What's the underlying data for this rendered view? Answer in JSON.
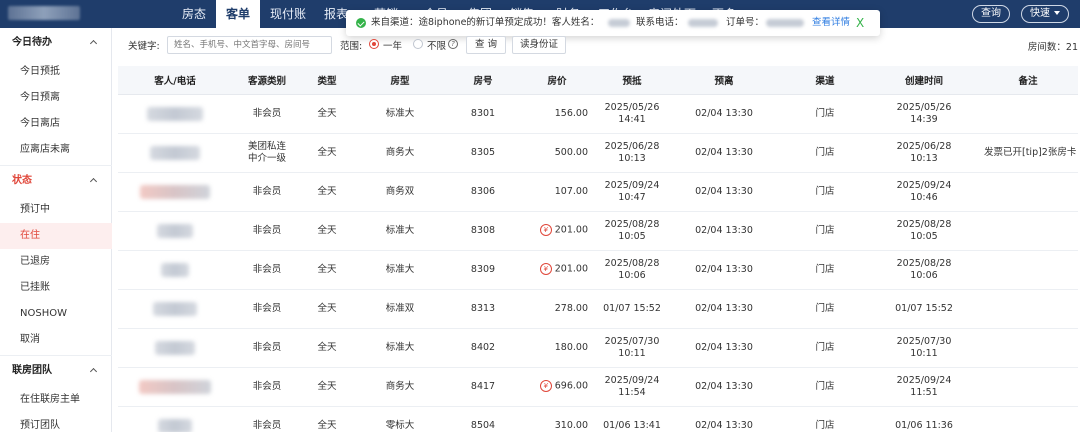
{
  "nav": {
    "tabs": [
      "房态",
      "客单",
      "现付账",
      "报表",
      "营销",
      "会员",
      "集团",
      "销售",
      "财务",
      "工作台",
      "房间外面",
      "更多"
    ],
    "active_index": 1,
    "query_button": "查询",
    "quick_button": "快速"
  },
  "notification": {
    "lead": "来自渠道：途8iphone的新订单预定成功！客人姓名：",
    "phone_label": "联系电话：",
    "order_label": "订单号：",
    "detail_link": "查看详情",
    "close_glyph": "X",
    "status_color": "#35b34a"
  },
  "sidebar": {
    "groups": [
      {
        "title": "今日待办",
        "color": "#222222",
        "items": [
          "今日预抵",
          "今日预离",
          "今日离店",
          "应离店未离"
        ]
      },
      {
        "title": "状态",
        "color": "#e0473a",
        "items": [
          "预订中",
          "在住",
          "已退房",
          "已挂账",
          "NOSHOW",
          "取消"
        ]
      },
      {
        "title": "联房团队",
        "color": "#222222",
        "items": [
          "在住联房主单",
          "预订团队"
        ]
      }
    ],
    "active_item": "在住"
  },
  "filter": {
    "keyword_label": "关键字:",
    "keyword_placeholder": "姓名、手机号、中文首字母、房间号",
    "range_label": "范围:",
    "option_year": "一年",
    "option_all": "不限",
    "help_glyph": "?",
    "query_button": "查 询",
    "idcard_button": "读身份证",
    "room_count": "房间数：21"
  },
  "table": {
    "headers": [
      "客人/电话",
      "客源类别",
      "类型",
      "房型",
      "房号",
      "房价",
      "预抵",
      "预离",
      "渠道",
      "创建时间",
      "备注"
    ],
    "rows": [
      {
        "category": "非会员",
        "type": "全天",
        "room_type": "标准大",
        "room_no": "8301",
        "price": "156.00",
        "price_icon": false,
        "arrive": [
          "2025/05/26",
          "14:41"
        ],
        "depart": "02/04 13:30",
        "channel": "门店",
        "created": [
          "2025/05/26",
          "14:39"
        ],
        "note": ""
      },
      {
        "category": [
          "美团私连",
          "中介一级"
        ],
        "type": "全天",
        "room_type": "商务大",
        "room_no": "8305",
        "price": "500.00",
        "price_icon": false,
        "arrive": [
          "2025/06/28",
          "10:13"
        ],
        "depart": "02/04 13:30",
        "channel": "门店",
        "created": [
          "2025/06/28",
          "10:13"
        ],
        "note": "发票已开[tip]2张房卡"
      },
      {
        "category": "非会员",
        "type": "全天",
        "room_type": "商务双",
        "room_no": "8306",
        "price": "107.00",
        "price_icon": false,
        "arrive": [
          "2025/09/24",
          "10:47"
        ],
        "depart": "02/04 13:30",
        "channel": "门店",
        "created": [
          "2025/09/24",
          "10:46"
        ],
        "note": ""
      },
      {
        "category": "非会员",
        "type": "全天",
        "room_type": "标准大",
        "room_no": "8308",
        "price": "201.00",
        "price_icon": true,
        "arrive": [
          "2025/08/28",
          "10:05"
        ],
        "depart": "02/04 13:30",
        "channel": "门店",
        "created": [
          "2025/08/28",
          "10:05"
        ],
        "note": ""
      },
      {
        "category": "非会员",
        "type": "全天",
        "room_type": "标准大",
        "room_no": "8309",
        "price": "201.00",
        "price_icon": true,
        "arrive": [
          "2025/08/28",
          "10:06"
        ],
        "depart": "02/04 13:30",
        "channel": "门店",
        "created": [
          "2025/08/28",
          "10:06"
        ],
        "note": ""
      },
      {
        "category": "非会员",
        "type": "全天",
        "room_type": "标准双",
        "room_no": "8313",
        "price": "278.00",
        "price_icon": false,
        "arrive": [
          "01/07 15:52"
        ],
        "depart": "02/04 13:30",
        "channel": "门店",
        "created": [
          "01/07 15:52"
        ],
        "note": ""
      },
      {
        "category": "非会员",
        "type": "全天",
        "room_type": "标准大",
        "room_no": "8402",
        "price": "180.00",
        "price_icon": false,
        "arrive": [
          "2025/07/30",
          "10:11"
        ],
        "depart": "02/04 13:30",
        "channel": "门店",
        "created": [
          "2025/07/30",
          "10:11"
        ],
        "note": ""
      },
      {
        "category": "非会员",
        "type": "全天",
        "room_type": "商务大",
        "room_no": "8417",
        "price": "696.00",
        "price_icon": true,
        "arrive": [
          "2025/09/24",
          "11:54"
        ],
        "depart": "02/04 13:30",
        "channel": "门店",
        "created": [
          "2025/09/24",
          "11:51"
        ],
        "note": ""
      },
      {
        "category": "非会员",
        "type": "全天",
        "room_type": "零标大",
        "room_no": "8504",
        "price": "310.00",
        "price_icon": false,
        "arrive": [
          "01/06 13:41"
        ],
        "depart": "02/04 13:30",
        "channel": "门店",
        "created": [
          "01/06 11:36"
        ],
        "note": ""
      }
    ],
    "price_icon_glyph": "¥"
  },
  "colors": {
    "nav_bg": "#1f3d6b",
    "accent_red": "#e0473a",
    "link_blue": "#2f7de1"
  }
}
